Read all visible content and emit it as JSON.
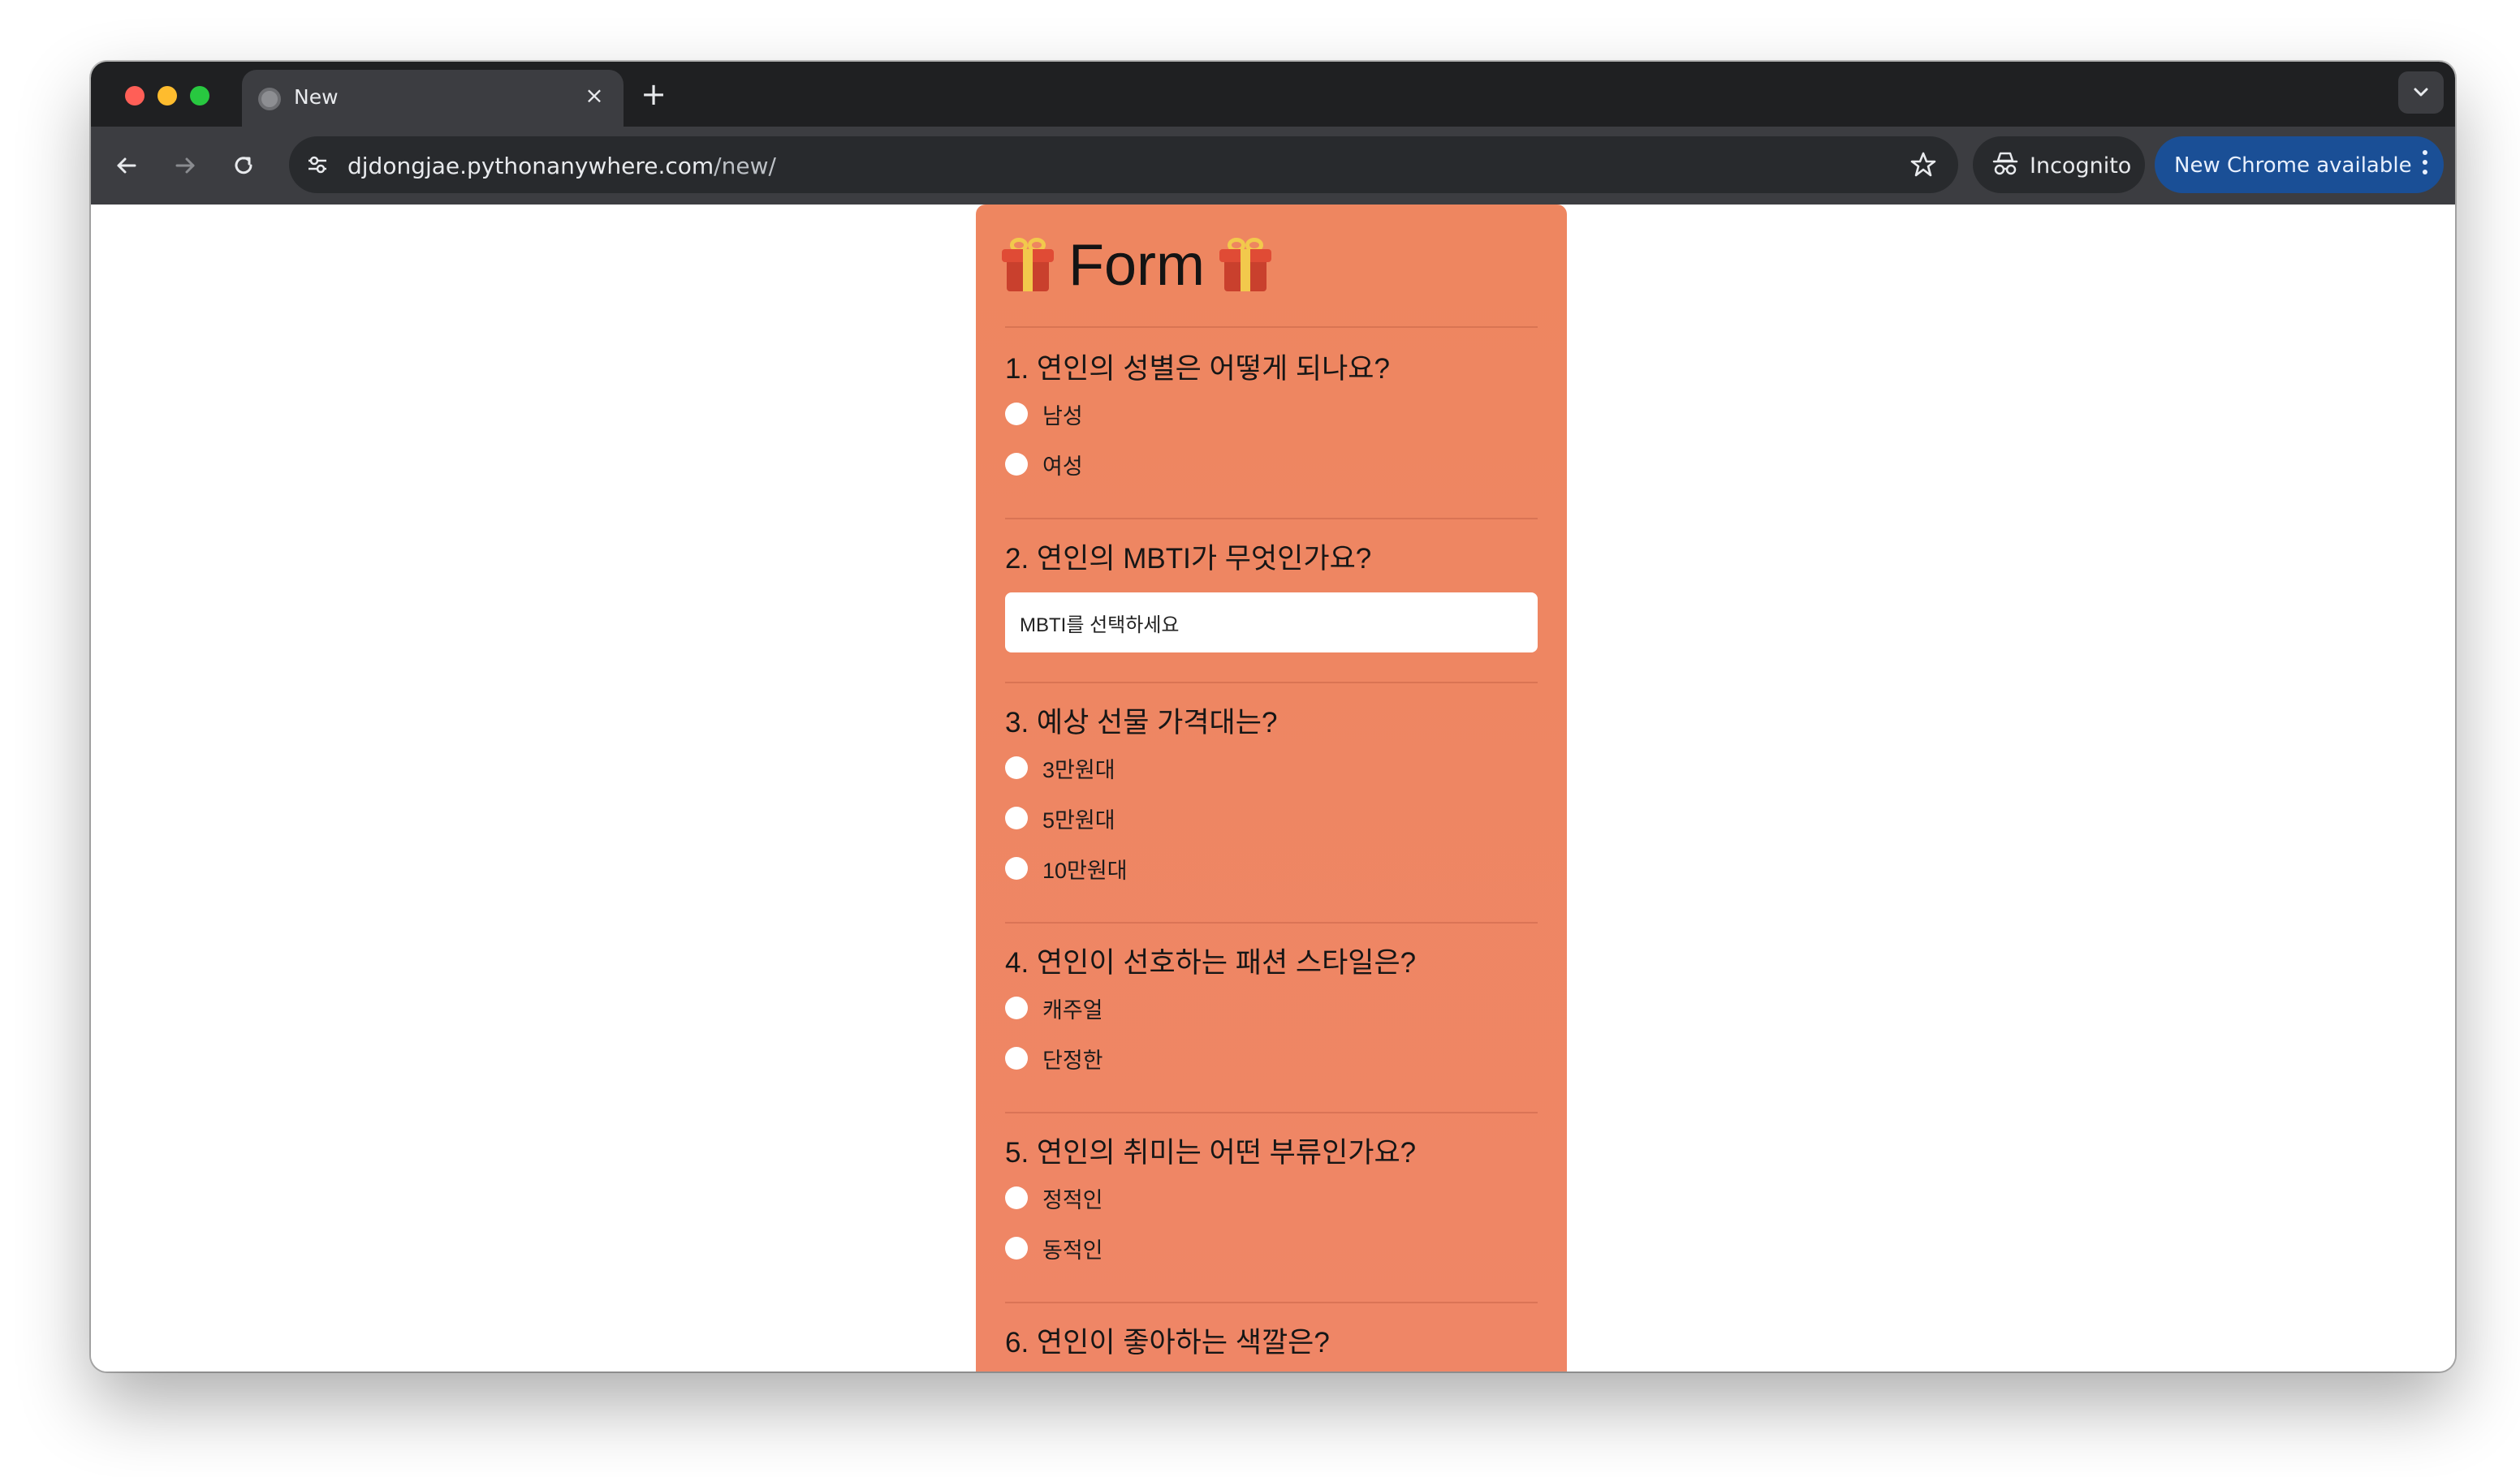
{
  "browser": {
    "tab_title": "New",
    "tab_close": "×",
    "new_tab": "+",
    "url_host": "djdongjae.pythonanywhere.com",
    "url_path": "/new/",
    "incognito_label": "Incognito",
    "update_label": "New Chrome available",
    "icons": {
      "back": "arrow-left-icon",
      "forward": "arrow-right-icon",
      "reload": "reload-icon",
      "site_info": "tune-icon",
      "bookmark": "star-icon",
      "incognito": "incognito-icon",
      "menu": "kebab-icon",
      "tab_search": "chevron-down-icon"
    }
  },
  "form": {
    "title": "Form",
    "title_icon": "gift-icon",
    "questions": [
      {
        "label": "1. 연인의 성별은 어떻게 되나요?",
        "options": [
          "남성",
          "여성"
        ]
      },
      {
        "label": "2. 연인의 MBTI가 무엇인가요?",
        "select_placeholder": "MBTI를 선택하세요"
      },
      {
        "label": "3. 예상 선물 가격대는?",
        "options": [
          "3만원대",
          "5만원대",
          "10만원대"
        ]
      },
      {
        "label": "4. 연인이 선호하는 패션 스타일은?",
        "options": [
          "캐주얼",
          "단정한"
        ]
      },
      {
        "label": "5. 연인의 취미는 어떤 부류인가요?",
        "options": [
          "정적인",
          "동적인"
        ]
      },
      {
        "label": "6. 연인이 좋아하는 색깔은?"
      }
    ]
  },
  "colors": {
    "card_background": "#ee8762",
    "chrome_dark": "#1f2022",
    "toolbar": "#3c3d41",
    "update_chip": "#1a4f96"
  }
}
